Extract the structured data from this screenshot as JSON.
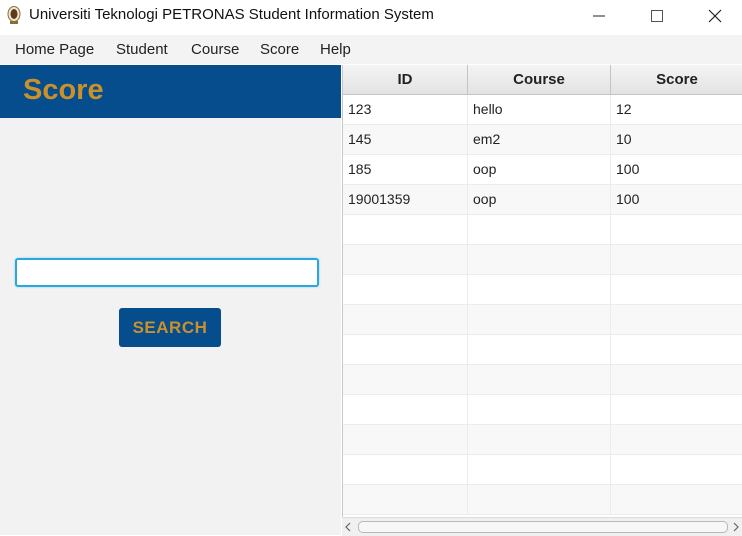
{
  "window": {
    "title": "Universiti Teknologi PETRONAS Student Information System",
    "icon": "app-logo-icon",
    "controls": [
      "minimize-icon",
      "maximize-icon",
      "close-icon"
    ]
  },
  "menu": {
    "items": [
      {
        "label": "Home Page"
      },
      {
        "label": "Student"
      },
      {
        "label": "Course"
      },
      {
        "label": "Score"
      },
      {
        "label": "Help"
      }
    ]
  },
  "left_panel": {
    "title": "Score",
    "search_value": "",
    "search_button": "SEARCH"
  },
  "table": {
    "columns": [
      "ID",
      "Course",
      "Score"
    ],
    "rows": [
      [
        "123",
        "hello",
        "12"
      ],
      [
        "145",
        "em2",
        "10"
      ],
      [
        "185",
        "oop",
        "100"
      ],
      [
        "19001359",
        "oop",
        "100"
      ],
      [
        "",
        "",
        ""
      ],
      [
        "",
        "",
        ""
      ],
      [
        "",
        "",
        ""
      ],
      [
        "",
        "",
        ""
      ],
      [
        "",
        "",
        ""
      ],
      [
        "",
        "",
        ""
      ],
      [
        "",
        "",
        ""
      ],
      [
        "",
        "",
        ""
      ],
      [
        "",
        "",
        ""
      ],
      [
        "",
        "",
        ""
      ]
    ]
  },
  "colors": {
    "accent_blue": "#054d8c",
    "accent_gold": "#c8912b",
    "focus_border": "#2aa7dc"
  }
}
